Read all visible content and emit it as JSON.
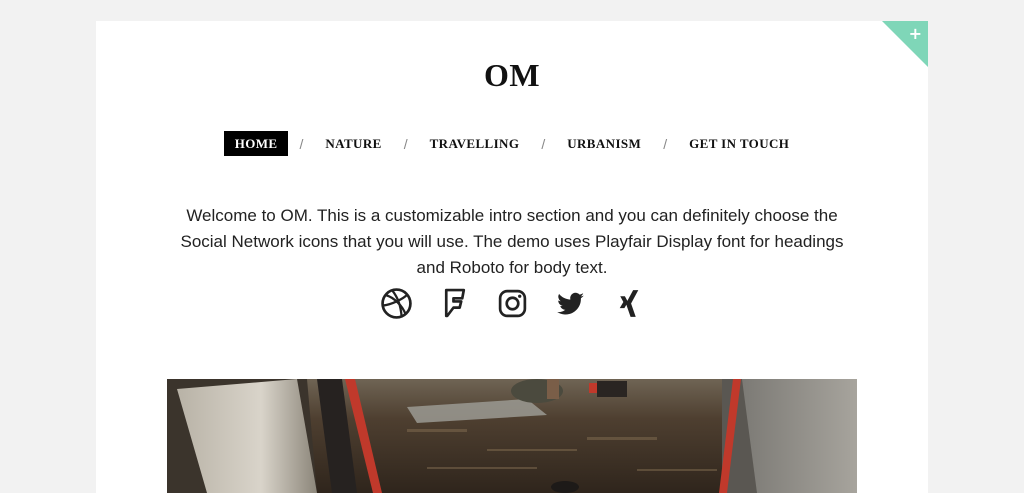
{
  "site": {
    "title": "OM"
  },
  "corner": {
    "icon": "plus-icon",
    "symbol": "+",
    "color": "#7fd6b8"
  },
  "nav": {
    "items": [
      {
        "label": "HOME",
        "active": true
      },
      {
        "label": "NATURE",
        "active": false
      },
      {
        "label": "TRAVELLING",
        "active": false
      },
      {
        "label": "URBANISM",
        "active": false
      },
      {
        "label": "GET IN TOUCH",
        "active": false
      }
    ],
    "separator": "/"
  },
  "intro": {
    "text": "Welcome to OM. This is a customizable intro section and you can definitely choose the Social Network icons that you will use. The demo uses Playfair Display font for headings and Roboto for body text."
  },
  "social": [
    {
      "name": "dribbble-icon"
    },
    {
      "name": "foursquare-icon"
    },
    {
      "name": "instagram-icon"
    },
    {
      "name": "twitter-icon"
    },
    {
      "name": "xing-icon"
    }
  ],
  "hero": {
    "image": "camping-tent-photo"
  }
}
